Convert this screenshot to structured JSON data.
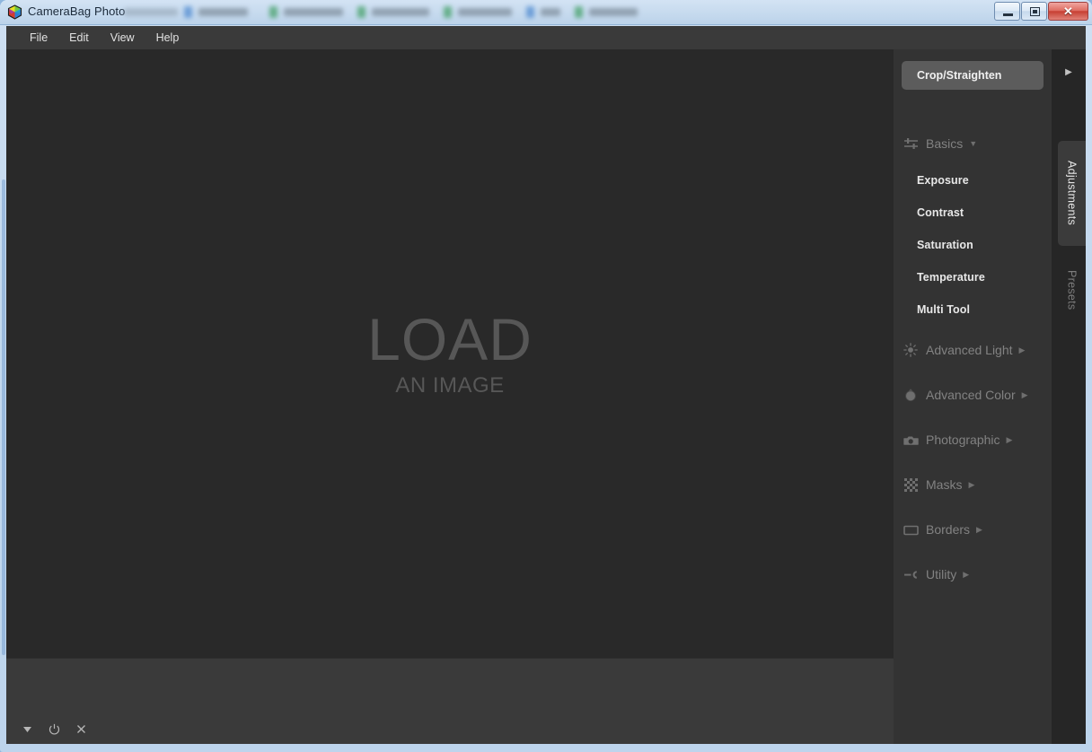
{
  "window": {
    "title": "CameraBag Photo",
    "app_icon": "color-cube-icon",
    "controls": {
      "minimize": "minimize-button",
      "restore": "restore-button",
      "close_label": "✕"
    }
  },
  "menubar": {
    "items": [
      {
        "label": "File"
      },
      {
        "label": "Edit"
      },
      {
        "label": "View"
      },
      {
        "label": "Help"
      }
    ]
  },
  "canvas": {
    "placeholder_main": "LOAD",
    "placeholder_sub": "AN IMAGE"
  },
  "filmstrip": {
    "tools": [
      {
        "name": "chevron-down-icon",
        "glyph": "▼"
      },
      {
        "name": "power-icon",
        "glyph": "⏻"
      },
      {
        "name": "close-icon",
        "glyph": "✕"
      }
    ]
  },
  "right_panel": {
    "crop_button": "Crop/Straighten",
    "groups": [
      {
        "label": "Basics",
        "icon": "sliders-icon",
        "expanded": true,
        "arrow": "▼",
        "tools": [
          {
            "label": "Exposure"
          },
          {
            "label": "Contrast"
          },
          {
            "label": "Saturation"
          },
          {
            "label": "Temperature"
          },
          {
            "label": "Multi Tool"
          }
        ]
      },
      {
        "label": "Advanced Light",
        "icon": "sun-icon",
        "expanded": false,
        "arrow": "▶",
        "tools": []
      },
      {
        "label": "Advanced Color",
        "icon": "color-drop-icon",
        "expanded": false,
        "arrow": "▶",
        "tools": []
      },
      {
        "label": "Photographic",
        "icon": "camera-icon",
        "expanded": false,
        "arrow": "▶",
        "tools": []
      },
      {
        "label": "Masks",
        "icon": "checkerboard-icon",
        "expanded": false,
        "arrow": "▶",
        "tools": []
      },
      {
        "label": "Borders",
        "icon": "rectangle-icon",
        "expanded": false,
        "arrow": "▶",
        "tools": []
      },
      {
        "label": "Utility",
        "icon": "wrench-icon",
        "expanded": false,
        "arrow": "▶",
        "tools": []
      }
    ]
  },
  "tab_rail": {
    "collapse_glyph": "▶",
    "tabs": [
      {
        "label": "Adjustments",
        "active": true
      },
      {
        "label": "Presets",
        "active": false
      }
    ]
  },
  "colors": {
    "frame": "#c6daee",
    "panel_bg": "#333333",
    "canvas_bg": "#292929",
    "menubar_bg": "#3a3a3a",
    "accent_button": "#5c5c5c",
    "close_button": "#c63d30",
    "text_primary": "#e8e8e8",
    "text_muted": "#828282"
  }
}
